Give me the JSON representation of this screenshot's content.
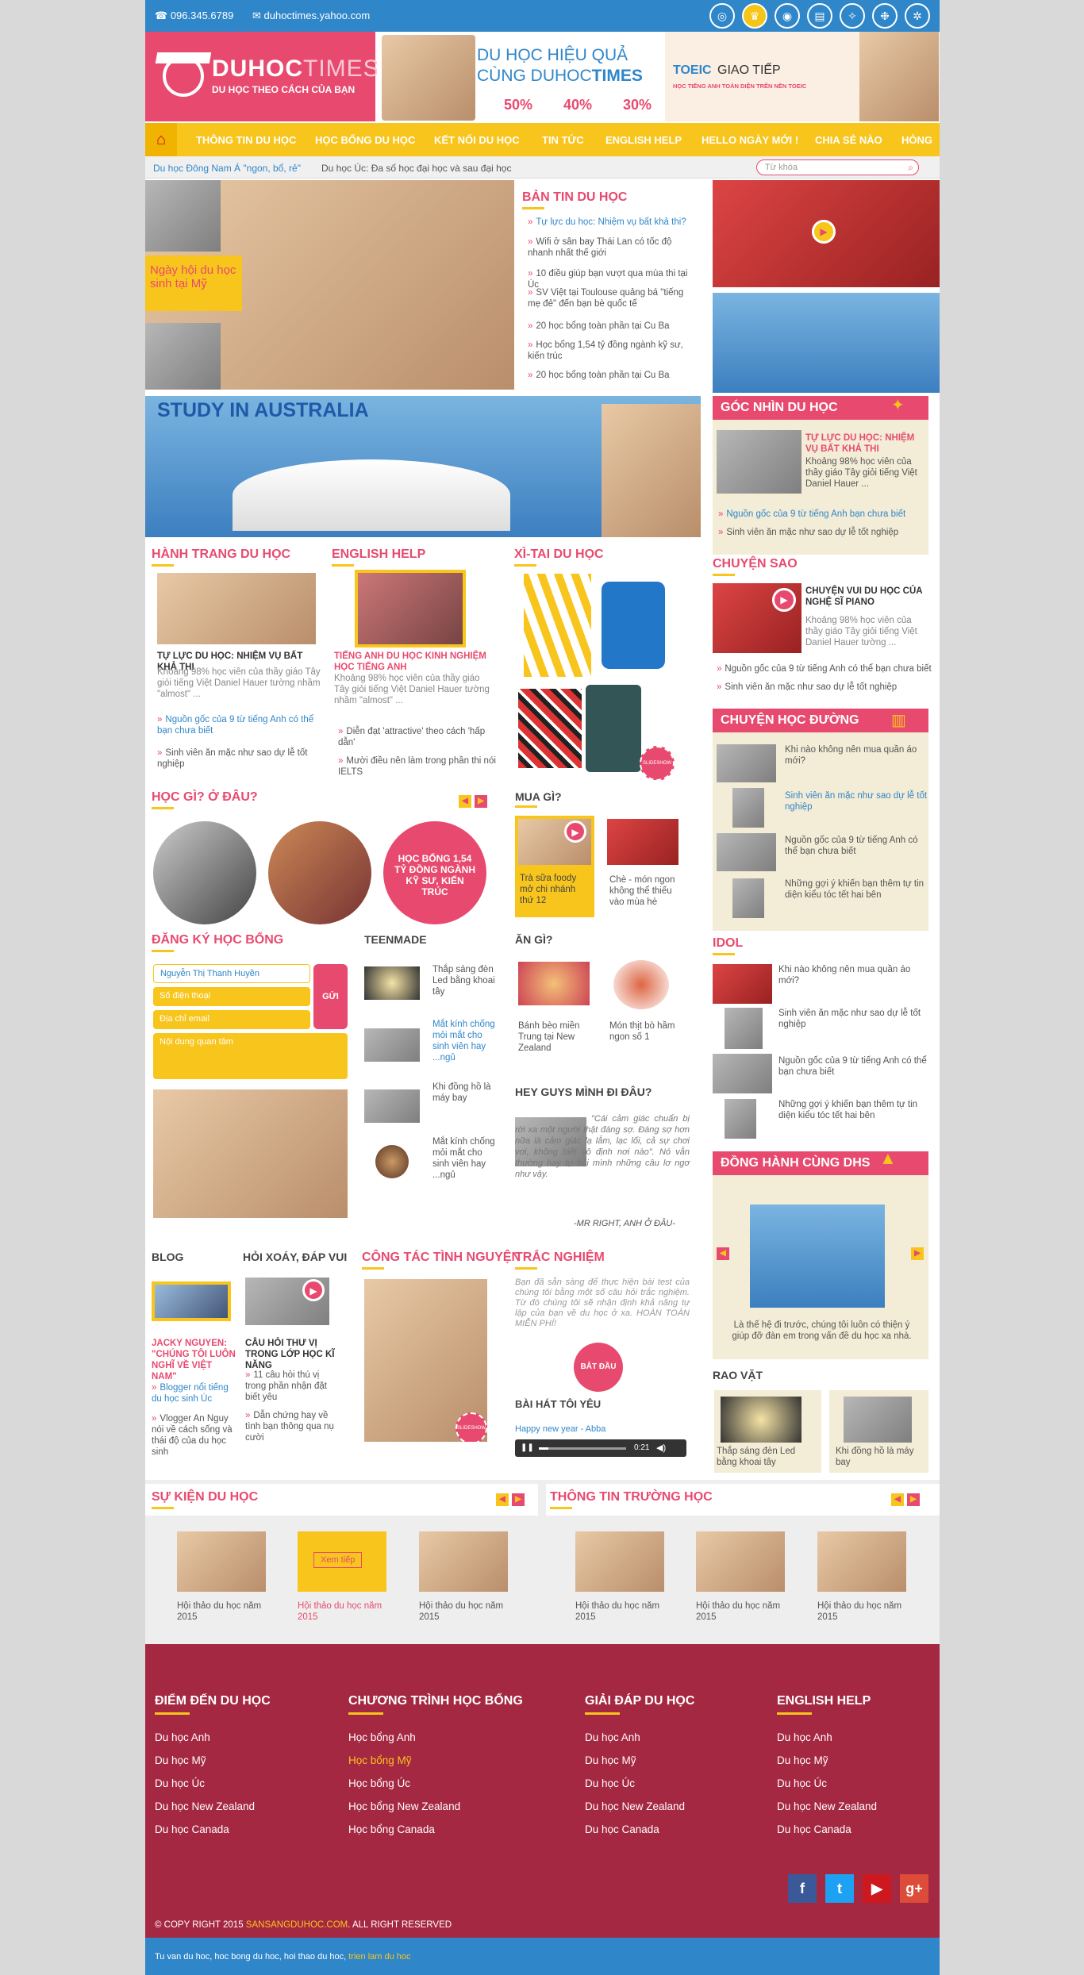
{
  "topbar": {
    "phone": "096.345.6789",
    "email": "duhoctimes.yahoo.com"
  },
  "logo": {
    "main": "DUHOC",
    "accent": "TIMES",
    "tagline": "DU HỌC THEO CÁCH CỦA BẠN"
  },
  "banner1": {
    "line1": "DU HỌC HIỆU QUẢ",
    "line2a": "CÙNG DUHOC",
    "line2b": "TIMES",
    "p1": "50%",
    "p2": "40%",
    "p3": "30%"
  },
  "banner2": {
    "brand": "TOEIC",
    "title": "GIAO TIẾP",
    "sub": "HỌC TIẾNG ANH TOÀN DIỆN TRÊN NỀN TOEIC"
  },
  "nav": [
    "THÔNG TIN DU HỌC",
    "HỌC BỔNG DU HỌC",
    "KẾT NỐI DU HỌC",
    "TIN TỨC",
    "ENGLISH HELP",
    "HELLO NGÀY MỚI !",
    "CHIA SẺ NÀO",
    "HÒNG"
  ],
  "sub": {
    "link1": "Du học Đông Nam Á \"ngon, bổ, rẻ\"",
    "link2": "Du học Úc: Đa số học đại học và sau đại học",
    "search_placeholder": "Từ khóa"
  },
  "hero": {
    "caption": "Ngày hội du học sinh tại Mỹ"
  },
  "bantin": {
    "title": "BẢN TIN DU HỌC",
    "items": [
      "Tự lực du học: Nhiệm vụ bất khả thi?",
      "Wifi ở sân bay Thái Lan có tốc độ nhanh nhất thế giới",
      "10 điều giúp bạn vượt qua mùa thi tại Úc",
      "SV Việt tại Toulouse quảng bá \"tiếng mẹ đẻ\" đến bạn bè quốc tế",
      "20 học bổng toàn phần tại Cu Ba",
      "Học bổng 1,54 tỷ đồng ngành kỹ sư, kiến trúc",
      "20 học bổng toàn phần tại Cu Ba"
    ]
  },
  "study_banner": "STUDY IN AUSTRALIA",
  "gocnhin": {
    "title": "GÓC NHÌN DU HỌC",
    "headline": "TỰ LỰC DU HỌC: NHIỆM VỤ BẤT KHẢ THI",
    "desc": "Khoảng 98% học viên của thầy giáo Tây giỏi tiếng Việt Daniel Hauer ...",
    "l1": "Nguồn gốc của 9 từ tiếng Anh bạn chưa biết",
    "l2": "Sinh viên ăn mặc như sao dự lễ tốt nghiệp"
  },
  "hanhtrang": {
    "title": "HÀNH TRANG DU HỌC",
    "headline": "TỰ LỰC DU HỌC: NHIỆM VỤ BẤT KHẢ THI",
    "desc": "Khoảng 98% học viên của thầy giáo Tây giỏi tiếng Việt Daniel Hauer tường nhầm \"almost\" ...",
    "l1": "Nguồn gốc của 9 từ tiếng Anh có thể bạn chưa biết",
    "l2": "Sinh viên ăn mặc như sao dự lễ tốt nghiệp"
  },
  "englishhelp": {
    "title": "ENGLISH HELP",
    "headline": "TIẾNG ANH DU HỌC KINH NGHIỆM HỌC TIẾNG ANH",
    "desc": "Khoảng 98% học viên của thầy giáo Tây giỏi tiếng Việt Daniel Hauer tường nhầm \"almost\" ...",
    "l1": "Diễn đạt 'attractive' theo cách 'hấp dẫn'",
    "l2": "Mười điều nên làm trong phần thi nói IELTS"
  },
  "xitai": {
    "title": "XÌ-TAI DU HỌC",
    "badge": "SLIDESHOW"
  },
  "chuyensao": {
    "title": "CHUYỆN SAO",
    "headline": "CHUYỆN VUI DU HỌC CỦA NGHỆ SĨ PIANO",
    "desc": "Khoảng 98% học viên của thầy giáo Tây giỏi tiếng Việt Daniel Hauer tường ...",
    "l1": "Nguồn gốc của 9 từ tiếng Anh có thể bạn chưa biết",
    "l2": "Sinh viên ăn mặc như sao dự lễ tốt nghiệp"
  },
  "hocgi": {
    "title": "HỌC GÌ? Ở ĐÂU?",
    "circle_text": "HỌC BỔNG 1,54 TỶ ĐỒNG NGÀNH KỸ SƯ, KIẾN TRÚC"
  },
  "muagi": {
    "title": "MUA GÌ?",
    "c1": "Trà sữa foody mở chi nhánh thứ 12",
    "c2": "Chè - món ngon không thể thiếu vào mùa hè"
  },
  "chuyenhocduong": {
    "title": "CHUYỆN HỌC ĐƯỜNG",
    "items": [
      "Khi nào không nên mua quần áo mới?",
      "Sinh viên ăn mặc như sao dự lễ tốt nghiệp",
      "Nguồn gốc của 9 từ tiếng Anh có thể bạn chưa biết",
      "Những gợi ý khiến bạn thêm tự tin diện kiểu tóc tết hai bên"
    ]
  },
  "dangky": {
    "title": "ĐĂNG KÝ HỌC BỔNG",
    "name": "Nguyễn Thị Thanh Huyền",
    "phone": "Số điện thoại",
    "email": "Địa chỉ email",
    "content": "Nội dung quan tâm",
    "send": "GỬI"
  },
  "teenmade": {
    "title": "TEENMADE",
    "items": [
      "Thắp sáng đèn Led bằng khoai tây",
      "Mắt kính chống mỏi mắt cho sinh viên hay ...ngủ",
      "Khi đồng hồ là máy bay",
      "Mắt kính chống mỏi mắt cho sinh viên hay ...ngủ"
    ]
  },
  "angi": {
    "title": "ĂN GÌ?",
    "c1": "Bánh bèo miền Trung tại New Zealand",
    "c2": "Món thịt bò hầm ngon số 1"
  },
  "heyguys": {
    "title": "HEY GUYS MÌNH ĐI ĐÂU?",
    "quote": "\"Cái cảm giác chuẩn bị rời xa một người thật đáng sợ. Đáng sợ hơn nữa là cảm giác lạ lẫm, lạc lối, cả sự chơi vơi, không biết vô định nơi nào\". Nó vẫn thường hay tự hỏi mình những câu lơ ngơ như vậy.",
    "author": "-MR RIGHT, ANH Ở ĐÂU-"
  },
  "idol": {
    "title": "IDOL",
    "items": [
      "Khi nào không nên mua quần áo mới?",
      "Sinh viên ăn mặc như sao dự lễ tốt nghiệp",
      "Nguồn gốc của 9 từ tiếng Anh có thể bạn chưa biết",
      "Những gợi ý khiến bạn thêm tự tin diện kiểu tóc tết hai bên"
    ]
  },
  "donghanh": {
    "title": "ĐỒNG HÀNH CÙNG DHS",
    "desc": "Là thế hệ đi trước, chúng tôi luôn có thiện ý giúp đỡ đàn em trong vấn đề du học xa nhà."
  },
  "blog": {
    "title": "BLOG",
    "headline": "JACKY NGUYEN: \"CHÚNG TÔI LUÔN NGHĨ VỀ VIỆT NAM\"",
    "l1": "Blogger nổi tiếng du học sinh Úc",
    "l2": "Vlogger An Nguy nói về cách sống và thái độ của du học sinh"
  },
  "hoixoay": {
    "title": "HỎI XOÁY, ĐÁP VUI",
    "headline": "CÂU HỎI THƯ VỊ TRONG LỚP HỌC KĨ NĂNG",
    "l1": "11 câu hỏi thú vị trong phần nhận đặt biết yêu",
    "l2": "Dẫn chứng hay về tình bạn thông qua nụ cười"
  },
  "congtac": {
    "title": "CÔNG TÁC TÌNH NGUYỆN",
    "badge": "SLIDESHOW"
  },
  "tracnghiem": {
    "title": "TRẮC NGHIỆM",
    "desc": "Bạn đã sẵn sàng để thực hiện bài test của chúng tôi bằng một số câu hỏi trắc nghiệm. Từ đó chúng tôi sẽ nhận định khả năng tự lập của bạn về du học ở xa. HOÀN TOÀN MIỄN PHÍ!",
    "start": "BẮT ĐẦU"
  },
  "baihat": {
    "title": "BÀI HÁT TÔI YÊU",
    "song": "Happy new year - Abba",
    "time": "0:21"
  },
  "raovat": {
    "title": "RAO VẶT",
    "c1": "Thắp sáng đèn Led bằng khoai tây",
    "c2": "Khi đồng hồ là máy bay"
  },
  "sukien": {
    "title": "SỰ KIỆN DU HỌC",
    "items": [
      "Hội thảo du học năm 2015",
      "Hội thảo du học năm 2015",
      "Hội thảo du học năm 2015"
    ],
    "more": "Xem tiếp"
  },
  "thongtin": {
    "title": "THÔNG TIN TRƯỜNG HỌC",
    "items": [
      "Hội thảo du học năm 2015",
      "Hội thảo du học năm 2015",
      "Hội thảo du học năm 2015"
    ]
  },
  "footer": {
    "cols": [
      {
        "title": "ĐIỂM ĐẾN DU HỌC",
        "items": [
          "Du học Anh",
          "Du học Mỹ",
          "Du học Úc",
          "Du học New Zealand",
          "Du học Canada"
        ]
      },
      {
        "title": "CHƯƠNG TRÌNH HỌC BỔNG",
        "items": [
          "Học bổng Anh",
          "Học bổng Mỹ",
          "Học bổng Úc",
          "Học bổng New Zealand",
          "Học bổng Canada"
        ]
      },
      {
        "title": "GIẢI ĐÁP DU HỌC",
        "items": [
          "Du học Anh",
          "Du học Mỹ",
          "Du học Úc",
          "Du học New Zealand",
          "Du học Canada"
        ]
      },
      {
        "title": "ENGLISH HELP",
        "items": [
          "Du học Anh",
          "Du học Mỹ",
          "Du học Úc",
          "Du học New Zealand",
          "Du học Canada"
        ]
      }
    ],
    "copy_pre": "© COPY RIGHT 2015",
    "copy_site": "SANSANGDUHOC.COM",
    "copy_post": ". ALL RIGHT RESERVED",
    "social": [
      "f",
      "t",
      "▶",
      "g+"
    ],
    "bottom_text": "Tu van du hoc, hoc bong du hoc, hoi thao du hoc,",
    "bottom_link": "trien lam du hoc"
  },
  "colors": {
    "pink": "#e84a6f",
    "yellow": "#f8c51c",
    "blue": "#2f86c9",
    "footer": "#a52842"
  }
}
